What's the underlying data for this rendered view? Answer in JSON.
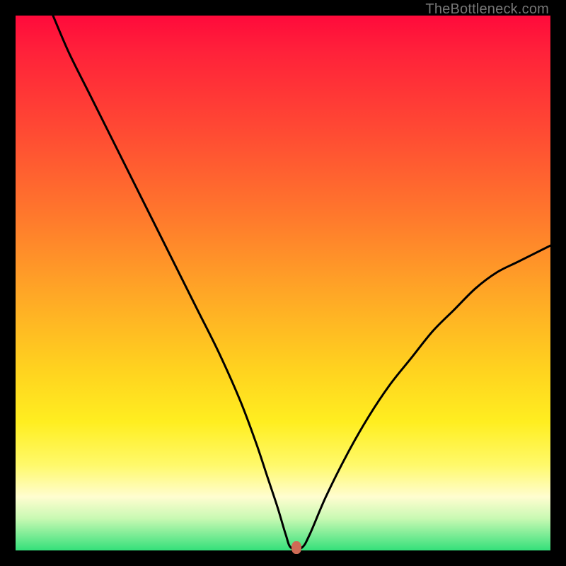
{
  "watermark": "TheBottleneck.com",
  "chart_data": {
    "type": "line",
    "title": "",
    "xlabel": "",
    "ylabel": "",
    "xlim": [
      0,
      100
    ],
    "ylim": [
      0,
      100
    ],
    "series": [
      {
        "name": "bottleneck-curve",
        "x": [
          7,
          10,
          14,
          18,
          22,
          26,
          30,
          34,
          38,
          42,
          45,
          47,
          49,
          50.5,
          51.5,
          53.5,
          55,
          58,
          62,
          66,
          70,
          74,
          78,
          82,
          86,
          90,
          94,
          100
        ],
        "values": [
          100,
          93,
          85,
          77,
          69,
          61,
          53,
          45,
          37,
          28,
          20,
          14,
          8,
          3,
          0.5,
          0.5,
          3,
          10,
          18,
          25,
          31,
          36,
          41,
          45,
          49,
          52,
          54,
          57
        ]
      }
    ],
    "annotations": [
      {
        "name": "optimal-point",
        "x": 52.5,
        "y": 0.5
      }
    ],
    "grid": false,
    "legend": false
  },
  "colors": {
    "curve": "#000000",
    "marker": "#cf6a55"
  }
}
